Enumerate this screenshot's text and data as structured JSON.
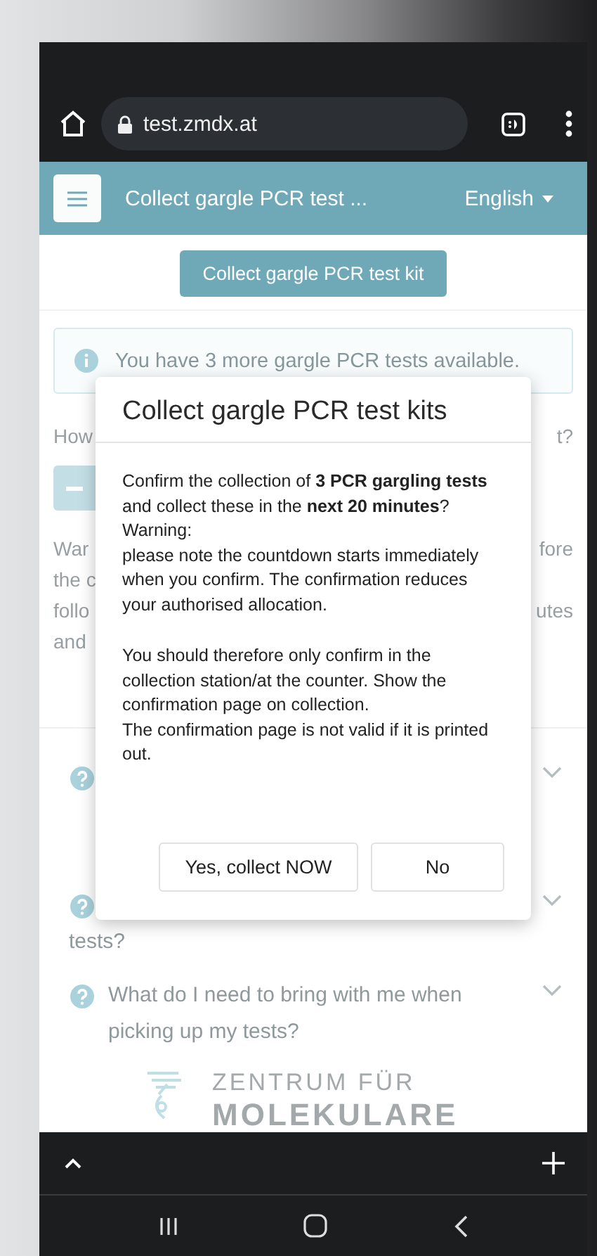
{
  "browser": {
    "url": "test.zmdx.at"
  },
  "app_bar": {
    "title": "Collect gargle PCR test ...",
    "language": "English"
  },
  "primary_button": "Collect gargle PCR test kit",
  "info_alert": "You have 3 more gargle PCR tests available.",
  "quantity_question": {
    "start": "How",
    "end": "t?"
  },
  "warning_lines": [
    {
      "start": "War",
      "end": "fore"
    },
    {
      "start": "the c"
    },
    {
      "start": "follo",
      "end": "utes"
    },
    {
      "start": "and"
    }
  ],
  "faq": [
    {
      "expanded": false
    },
    {
      "expanded": false,
      "question_end": "tests?"
    },
    {
      "expanded": false,
      "question": "What do I need to bring with me when picking up my tests?"
    }
  ],
  "footer_logo": {
    "line_1": "ZENTRUM FÜR",
    "line_2": "MOLEKULARE"
  },
  "dialog": {
    "title": "Collect gargle PCR test kits",
    "paragraphs": [
      [
        "Confirm the collection of **3 PCR gargling tests** and collect these in the **next 20 minutes**?",
        "Warning:",
        "please note the countdown starts immediately when you confirm. The confirmation reduces your authorised allocation."
      ],
      [
        "You should therefore only confirm in the collection station/at the counter. Show the confirmation page on collection.",
        "The confirmation page is not valid if it is printed out."
      ]
    ],
    "buttons": [
      {
        "label": "Yes, collect NOW",
        "kind": "confirm"
      },
      {
        "label": "No",
        "kind": "cancel"
      }
    ]
  }
}
